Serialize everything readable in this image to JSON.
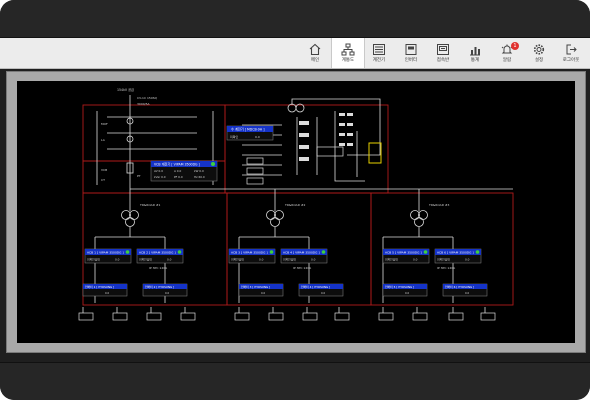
{
  "toolbar": {
    "items": [
      {
        "label": "메인",
        "icon": "home-icon",
        "active": false
      },
      {
        "label": "계통도",
        "icon": "network-icon",
        "active": true
      },
      {
        "label": "계전기",
        "icon": "relay-icon",
        "active": false
      },
      {
        "label": "인버터",
        "icon": "inverter-icon",
        "active": false
      },
      {
        "label": "접속반",
        "icon": "junction-box-icon",
        "active": false
      },
      {
        "label": "통계",
        "icon": "chart-icon",
        "active": false
      },
      {
        "label": "알람",
        "icon": "alarm-icon",
        "active": false,
        "badge": "1"
      },
      {
        "label": "설정",
        "icon": "gear-icon",
        "active": false
      },
      {
        "label": "로그아웃",
        "icon": "logout-icon",
        "active": false
      }
    ]
  },
  "diagram": {
    "top_labels": {
      "source": "154kV 공급",
      "cable": "CV-1C 150SQ",
      "ratio": "3000/5A"
    },
    "vcb": {
      "title": "VCB 계전기 [ VIPAM 3500DG ]",
      "values": [
        "AV 0.0",
        "A 0.0",
        "kW 0.0",
        "kVar 0.0",
        "PF 0.0",
        "Hz 60.0"
      ]
    },
    "relay": {
      "title": "수 계전기 [ MDCB-9H ]",
      "value_label": "미확인",
      "value": "0.0"
    },
    "side_labels": [
      "VCB",
      "VCB",
      "TR1",
      "TR2",
      "TR3",
      "MOF",
      "LA",
      "COS",
      "PT",
      "CT"
    ],
    "tr_labels": [
      "TR&ROAD #1",
      "TR&ROAD #2",
      "TR&ROAD #3"
    ],
    "acb_panels": [
      {
        "title": "ACB 1 [ VIPAM 3500DG ]",
        "sub": "미확인상태",
        "value": "0.0"
      },
      {
        "title": "ACB 2 [ VIPAM 3500DG ]",
        "sub": "미확인상태",
        "value": "0.0"
      },
      {
        "title": "ACB 3 [ VIPAM 3500DG ]",
        "sub": "미확인상태",
        "value": "0.0"
      },
      {
        "title": "ACB 4 [ VIPAM 3500DG ]",
        "sub": "미확인상태",
        "value": "0.0"
      },
      {
        "title": "ACB 5 [ VIPAM 3500DG ]",
        "sub": "미확인상태",
        "value": "0.0"
      },
      {
        "title": "ACB 6 [ VIPAM 3500DG ]",
        "sub": "미확인상태",
        "value": "0.0"
      }
    ],
    "inverter_panels": [
      {
        "title": "인버터 1 [ HYOSUNG ]",
        "value": "0.0"
      },
      {
        "title": "인버터 2 [ HYOSUNG ]",
        "value": "0.0"
      },
      {
        "title": "인버터 3 [ HYOSUNG ]",
        "value": "0.0"
      },
      {
        "title": "인버터 4 [ HYOSUNG ]",
        "value": "0.0"
      },
      {
        "title": "인버터 5 [ HYOSUNG ]",
        "value": "0.0"
      },
      {
        "title": "인버터 6 [ HYOSUNG ]",
        "value": "0.0"
      }
    ],
    "small_labels": [
      "IP 3PC 120A",
      "IP 3PC 120A",
      "IP 3PC 120A"
    ],
    "colors": {
      "panel_header": "#1533c8",
      "line": "#e8e8e8",
      "box": "#c21e1e",
      "ok": "#3ecf3e",
      "warn": "#e8d200"
    }
  }
}
